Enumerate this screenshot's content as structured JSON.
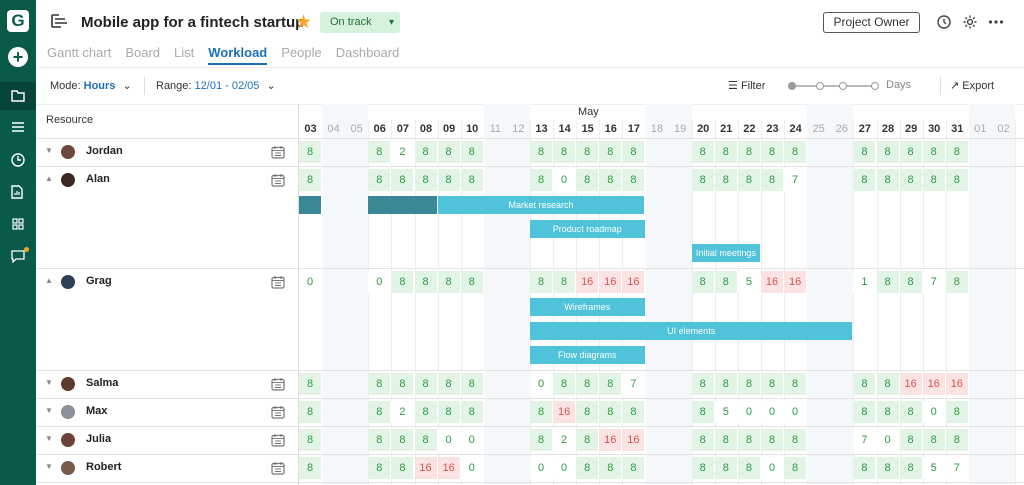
{
  "sidebar": {
    "logo": "G",
    "add_label": "+"
  },
  "header": {
    "title": "Mobile app for a fintech startup",
    "status": "On track",
    "owner_button": "Project Owner"
  },
  "tabs": [
    "Gantt chart",
    "Board",
    "List",
    "Workload",
    "People",
    "Dashboard"
  ],
  "active_tab": "Workload",
  "toolbar": {
    "mode_label": "Mode:",
    "mode_value": "Hours",
    "range_label": "Range:",
    "range_value": "12/01 - 02/05",
    "filter": "Filter",
    "zoom_label": "Days",
    "export": "Export"
  },
  "grid": {
    "resource_header": "Resource",
    "month": "May",
    "days": [
      "03",
      "04",
      "05",
      "06",
      "07",
      "08",
      "09",
      "10",
      "11",
      "12",
      "13",
      "14",
      "15",
      "16",
      "17",
      "18",
      "19",
      "20",
      "21",
      "22",
      "23",
      "24",
      "25",
      "26",
      "27",
      "28",
      "29",
      "30",
      "31",
      "01",
      "02"
    ],
    "weekend": [
      false,
      true,
      true,
      false,
      false,
      false,
      false,
      false,
      true,
      true,
      false,
      false,
      false,
      false,
      false,
      true,
      true,
      false,
      false,
      false,
      false,
      false,
      true,
      true,
      false,
      false,
      false,
      false,
      false,
      true,
      true
    ]
  },
  "resources": [
    {
      "name": "Jordan",
      "expanded": false,
      "hours": [
        "8",
        "",
        "",
        "8",
        "2",
        "8",
        "8",
        "8",
        "",
        "",
        "8",
        "8",
        "8",
        "8",
        "8",
        "",
        "",
        "8",
        "8",
        "8",
        "8",
        "8",
        "",
        "",
        "8",
        "8",
        "8",
        "8",
        "8",
        "",
        ""
      ],
      "tasks": []
    },
    {
      "name": "Alan",
      "expanded": true,
      "hours": [
        "8",
        "",
        "",
        "8",
        "8",
        "8",
        "8",
        "8",
        "",
        "",
        "8",
        "0",
        "8",
        "8",
        "8",
        "",
        "",
        "8",
        "8",
        "8",
        "8",
        "7",
        "",
        "",
        "8",
        "8",
        "8",
        "8",
        "8",
        "",
        ""
      ],
      "tasks": [
        {
          "label": "",
          "start": 0,
          "span": 1,
          "row": 0,
          "dark": true
        },
        {
          "label": "",
          "start": 3,
          "span": 3,
          "row": 0,
          "dark": true
        },
        {
          "label": "Market research",
          "start": 6,
          "span": 9,
          "row": 0,
          "dark": false
        },
        {
          "label": "Product roadmap",
          "start": 10,
          "span": 5,
          "row": 1,
          "dark": false
        },
        {
          "label": "Initial meetings",
          "start": 17,
          "span": 3,
          "row": 2,
          "dark": false
        }
      ]
    },
    {
      "name": "Grag",
      "expanded": true,
      "hours": [
        "0",
        "",
        "",
        "0",
        "8",
        "8",
        "8",
        "8",
        "",
        "",
        "8",
        "8",
        "16",
        "16",
        "16",
        "",
        "",
        "8",
        "8",
        "5",
        "16",
        "16",
        "",
        "",
        "1",
        "8",
        "8",
        "7",
        "8",
        "",
        ""
      ],
      "tasks": [
        {
          "label": "Wireframes",
          "start": 10,
          "span": 5,
          "row": 0,
          "dark": false
        },
        {
          "label": "UI elements",
          "start": 10,
          "span": 14,
          "row": 1,
          "dark": false
        },
        {
          "label": "Flow diagrams",
          "start": 10,
          "span": 5,
          "row": 2,
          "dark": false
        }
      ]
    },
    {
      "name": "Salma",
      "expanded": false,
      "hours": [
        "8",
        "",
        "",
        "8",
        "8",
        "8",
        "8",
        "8",
        "",
        "",
        "0",
        "8",
        "8",
        "8",
        "7",
        "",
        "",
        "8",
        "8",
        "8",
        "8",
        "8",
        "",
        "",
        "8",
        "8",
        "16",
        "16",
        "16",
        "",
        ""
      ],
      "tasks": []
    },
    {
      "name": "Max",
      "expanded": false,
      "hours": [
        "8",
        "",
        "",
        "8",
        "2",
        "8",
        "8",
        "8",
        "",
        "",
        "8",
        "16",
        "8",
        "8",
        "8",
        "",
        "",
        "8",
        "5",
        "0",
        "0",
        "0",
        "",
        "",
        "8",
        "8",
        "8",
        "0",
        "8",
        "",
        ""
      ],
      "tasks": []
    },
    {
      "name": "Julia",
      "expanded": false,
      "hours": [
        "8",
        "",
        "",
        "8",
        "8",
        "8",
        "0",
        "0",
        "",
        "",
        "8",
        "2",
        "8",
        "16",
        "16",
        "",
        "",
        "8",
        "8",
        "8",
        "8",
        "8",
        "",
        "",
        "7",
        "0",
        "8",
        "8",
        "8",
        "",
        ""
      ],
      "tasks": []
    },
    {
      "name": "Robert",
      "expanded": false,
      "hours": [
        "8",
        "",
        "",
        "8",
        "8",
        "16",
        "16",
        "0",
        "",
        "",
        "0",
        "0",
        "8",
        "8",
        "8",
        "",
        "",
        "8",
        "8",
        "8",
        "0",
        "8",
        "",
        "",
        "8",
        "8",
        "8",
        "5",
        "7",
        "",
        ""
      ],
      "tasks": []
    }
  ],
  "colors": {
    "sidebar": "#0a5a4a",
    "accent": "#1e6fb8",
    "ok": "#e2f4e6",
    "over": "#fbe3e3",
    "task": "#4ec3d9",
    "task_dark": "#3a8796"
  }
}
